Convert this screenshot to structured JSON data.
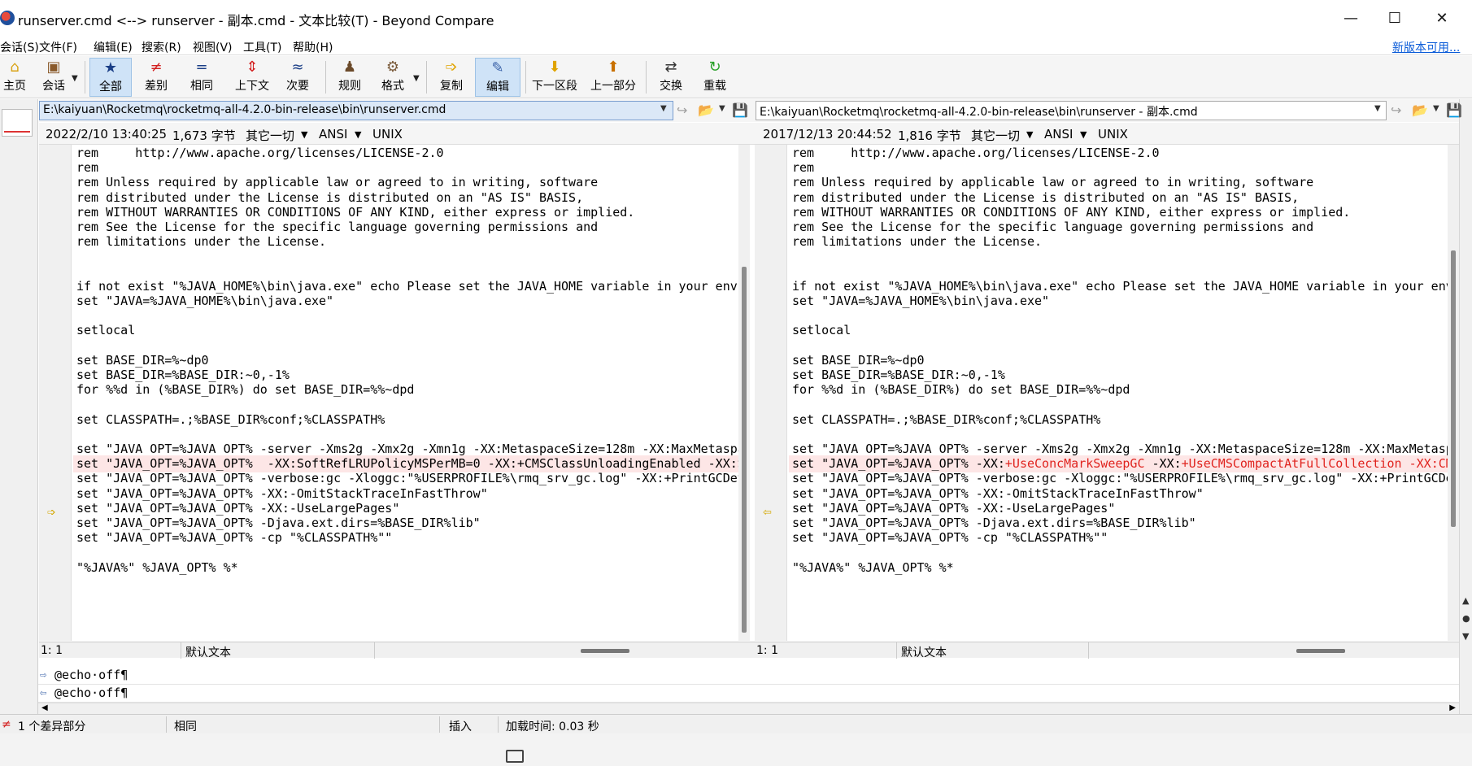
{
  "window": {
    "title": "runserver.cmd <--> runserver - 副本.cmd - 文本比较(T) - Beyond Compare",
    "minimize": "—",
    "maximize": "☐",
    "close": "✕"
  },
  "menu": {
    "items": [
      "会话(S)",
      "文件(F)",
      "编辑(E)",
      "搜索(R)",
      "视图(V)",
      "工具(T)",
      "帮助(H)"
    ],
    "update_link": "新版本可用..."
  },
  "toolbar": {
    "home": "主页",
    "session": "会话",
    "all": "全部",
    "diffs": "差别",
    "same": "相同",
    "context": "上下文",
    "minor": "次要",
    "rules": "规则",
    "format": "格式",
    "copy": "复制",
    "edit": "编辑",
    "next_section": "下一区段",
    "prev_section": "上一部分",
    "swap": "交换",
    "reload": "重载"
  },
  "left": {
    "path": "E:\\kaiyuan\\Rocketmq\\rocketmq-all-4.2.0-bin-release\\bin\\runserver.cmd",
    "date": "2022/2/10 13:40:25",
    "size": "1,673 字节",
    "mode": "其它一切",
    "encoding": "ANSI",
    "eol": "UNIX",
    "position": "1: 1",
    "text_type": "默认文本"
  },
  "right": {
    "path": "E:\\kaiyuan\\Rocketmq\\rocketmq-all-4.2.0-bin-release\\bin\\runserver - 副本.cmd",
    "date": "2017/12/13 20:44:52",
    "size": "1,816 字节",
    "mode": "其它一切",
    "encoding": "ANSI",
    "eol": "UNIX",
    "position": "1: 1",
    "text_type": "默认文本"
  },
  "left_lines": [
    "rem     http://www.apache.org/licenses/LICENSE-2.0",
    "rem",
    "rem Unless required by applicable law or agreed to in writing, software",
    "rem distributed under the License is distributed on an \"AS IS\" BASIS,",
    "rem WITHOUT WARRANTIES OR CONDITIONS OF ANY KIND, either express or implied.",
    "rem See the License for the specific language governing permissions and",
    "rem limitations under the License.",
    "",
    "",
    "if not exist \"%JAVA_HOME%\\bin\\java.exe\" echo Please set the JAVA_HOME variable in your envi",
    "set \"JAVA=%JAVA_HOME%\\bin\\java.exe\"",
    "",
    "setlocal",
    "",
    "set BASE_DIR=%~dp0",
    "set BASE_DIR=%BASE_DIR:~0,-1%",
    "for %%d in (%BASE_DIR%) do set BASE_DIR=%%~dpd",
    "",
    "set CLASSPATH=.;%BASE_DIR%conf;%CLASSPATH%",
    "",
    "set \"JAVA_OPT=%JAVA_OPT% -server -Xms2g -Xmx2g -Xmn1g -XX:MetaspaceSize=128m -XX:MaxMetaspa",
    "set \"JAVA_OPT=%JAVA_OPT%  -XX:SoftRefLRUPolicyMSPerMB=0 -XX:+CMSClassUnloadingEnabled -XX:S",
    "set \"JAVA_OPT=%JAVA_OPT% -verbose:gc -Xloggc:\"%USERPROFILE%\\rmq_srv_gc.log\" -XX:+PrintGCDet",
    "set \"JAVA_OPT=%JAVA_OPT% -XX:-OmitStackTraceInFastThrow\"",
    "set \"JAVA_OPT=%JAVA_OPT% -XX:-UseLargePages\"",
    "set \"JAVA_OPT=%JAVA_OPT% -Djava.ext.dirs=%BASE_DIR%lib\"",
    "set \"JAVA_OPT=%JAVA_OPT% -cp \"%CLASSPATH%\"\"",
    "",
    "\"%JAVA%\" %JAVA_OPT% %*"
  ],
  "right_lines": [
    "rem     http://www.apache.org/licenses/LICENSE-2.0",
    "rem",
    "rem Unless required by applicable law or agreed to in writing, software",
    "rem distributed under the License is distributed on an \"AS IS\" BASIS,",
    "rem WITHOUT WARRANTIES OR CONDITIONS OF ANY KIND, either express or implied.",
    "rem See the License for the specific language governing permissions and",
    "rem limitations under the License.",
    "",
    "",
    "if not exist \"%JAVA_HOME%\\bin\\java.exe\" echo Please set the JAVA_HOME variable in your envi",
    "set \"JAVA=%JAVA_HOME%\\bin\\java.exe\"",
    "",
    "setlocal",
    "",
    "set BASE_DIR=%~dp0",
    "set BASE_DIR=%BASE_DIR:~0,-1%",
    "for %%d in (%BASE_DIR%) do set BASE_DIR=%%~dpd",
    "",
    "set CLASSPATH=.;%BASE_DIR%conf;%CLASSPATH%",
    "",
    "set \"JAVA_OPT=%JAVA_OPT% -server -Xms2g -Xmx2g -Xmn1g -XX:MetaspaceSize=128m -XX:MaxMetaspa",
    "",
    "set \"JAVA_OPT=%JAVA_OPT% -verbose:gc -Xloggc:\"%USERPROFILE%\\rmq_srv_gc.log\" -XX:+PrintGCDet",
    "set \"JAVA_OPT=%JAVA_OPT% -XX:-OmitStackTraceInFastThrow\"",
    "set \"JAVA_OPT=%JAVA_OPT% -XX:-UseLargePages\"",
    "set \"JAVA_OPT=%JAVA_OPT% -Djava.ext.dirs=%BASE_DIR%lib\"",
    "set \"JAVA_OPT=%JAVA_OPT% -cp \"%CLASSPATH%\"\"",
    "",
    "\"%JAVA%\" %JAVA_OPT% %*"
  ],
  "right_diff_line": {
    "prefix": "set \"JAVA_OPT=%JAVA_OPT% -XX:",
    "hl1": "+UseConcMarkSweepGC",
    "mid": " -XX:",
    "hl2": "+UseCMSCompactAtFullCollection -XX:CMS"
  },
  "detail": {
    "left": "@echo·off¶",
    "right": "@echo·off¶"
  },
  "status": {
    "diff_count": "1 个差异部分",
    "same": "相同",
    "insert": "插入",
    "load_time": "加载时间: 0.03 秒"
  },
  "colors": {
    "diff_bg": "#fde6e6",
    "diff_text": "#e0241f",
    "active_tool": "#cfe3f7"
  }
}
